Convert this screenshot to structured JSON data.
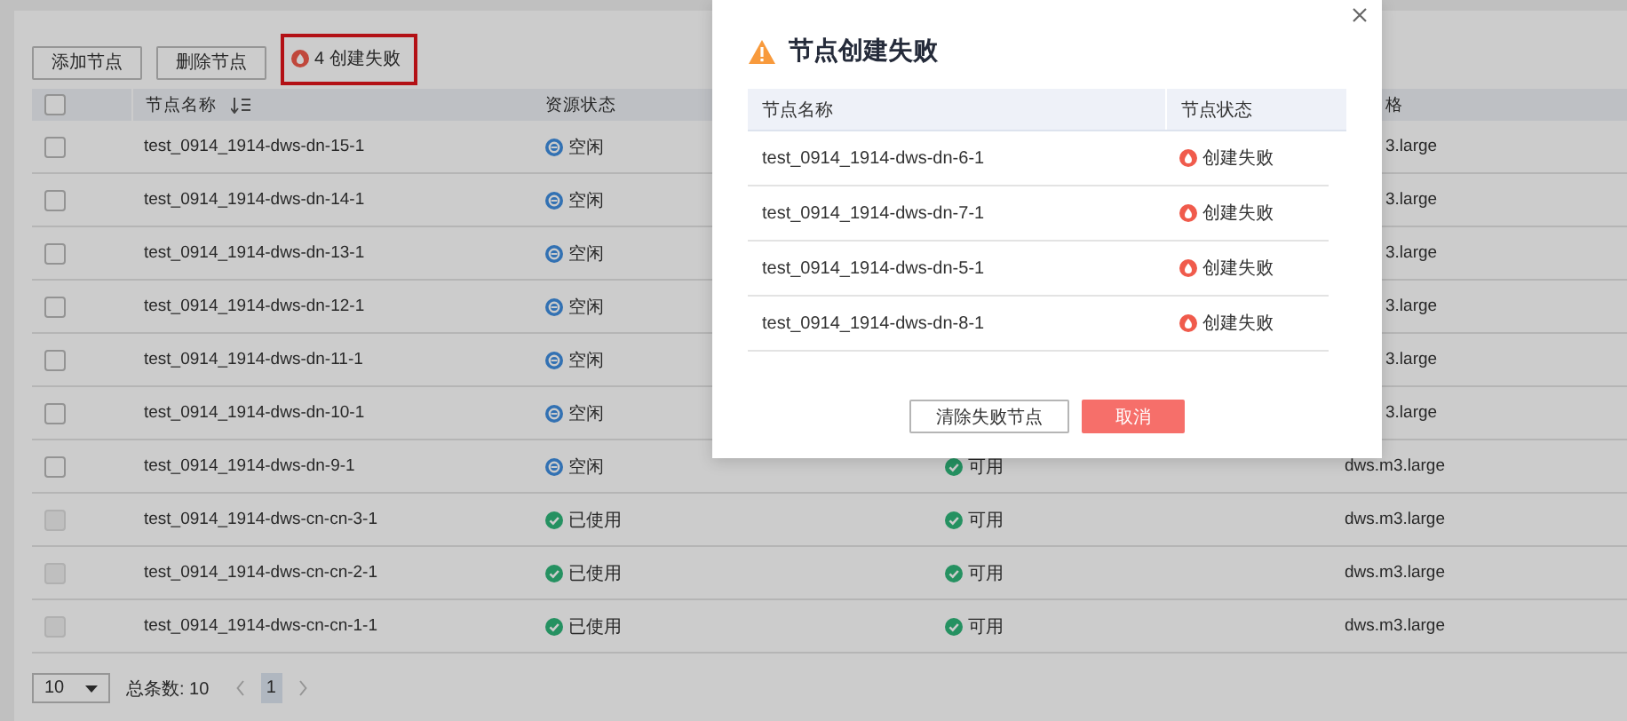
{
  "toolbar": {
    "buttons": [
      {
        "label": "添加节点"
      },
      {
        "label": "删除节点"
      }
    ],
    "failure_notice": {
      "text": "4 创建失败",
      "highlighted": true
    }
  },
  "table": {
    "header": {
      "checked": false,
      "name": "节点名称",
      "resource_status": "资源状态",
      "column_5": "格"
    },
    "rows": [
      {
        "checked": false,
        "disabled": false,
        "name": "test_0914_1914-dws-dn-15-1",
        "resource_status": {
          "kind": "idle",
          "text": "空闲"
        },
        "column_5": "3.large"
      },
      {
        "checked": false,
        "disabled": false,
        "name": "test_0914_1914-dws-dn-14-1",
        "resource_status": {
          "kind": "idle",
          "text": "空闲"
        },
        "column_5": "3.large"
      },
      {
        "checked": false,
        "disabled": false,
        "name": "test_0914_1914-dws-dn-13-1",
        "resource_status": {
          "kind": "idle",
          "text": "空闲"
        },
        "column_5": "3.large"
      },
      {
        "checked": false,
        "disabled": false,
        "name": "test_0914_1914-dws-dn-12-1",
        "resource_status": {
          "kind": "idle",
          "text": "空闲"
        },
        "column_5": "3.large"
      },
      {
        "checked": false,
        "disabled": false,
        "name": "test_0914_1914-dws-dn-11-1",
        "resource_status": {
          "kind": "idle",
          "text": "空闲"
        },
        "column_5": "3.large"
      },
      {
        "checked": false,
        "disabled": false,
        "name": "test_0914_1914-dws-dn-10-1",
        "resource_status": {
          "kind": "idle",
          "text": "空闲"
        },
        "column_5": "3.large"
      },
      {
        "checked": false,
        "disabled": false,
        "name": "test_0914_1914-dws-dn-9-1",
        "resource_status": {
          "kind": "idle",
          "text": "空闲"
        },
        "column_4": {
          "kind": "ok",
          "text": "可用"
        },
        "column_5": "dws.m3.large"
      },
      {
        "checked": false,
        "disabled": true,
        "name": "test_0914_1914-dws-cn-cn-3-1",
        "resource_status": {
          "kind": "ok",
          "text": "已使用"
        },
        "column_4": {
          "kind": "ok",
          "text": "可用"
        },
        "column_5": "dws.m3.large"
      },
      {
        "checked": false,
        "disabled": true,
        "name": "test_0914_1914-dws-cn-cn-2-1",
        "resource_status": {
          "kind": "ok",
          "text": "已使用"
        },
        "column_4": {
          "kind": "ok",
          "text": "可用"
        },
        "column_5": "dws.m3.large"
      },
      {
        "checked": false,
        "disabled": true,
        "name": "test_0914_1914-dws-cn-cn-1-1",
        "resource_status": {
          "kind": "ok",
          "text": "已使用"
        },
        "column_4": {
          "kind": "ok",
          "text": "可用"
        },
        "column_5": "dws.m3.large"
      }
    ]
  },
  "pagination": {
    "page_size": "10",
    "total": "总条数: 10",
    "pages": [
      {
        "label": "1",
        "selected": true
      }
    ]
  },
  "dialog": {
    "title": "节点创建失败",
    "columns": [
      "节点名称",
      "节点状态"
    ],
    "rows": [
      {
        "name": "test_0914_1914-dws-dn-6-1",
        "status": {
          "kind": "failed",
          "text": "创建失败"
        }
      },
      {
        "name": "test_0914_1914-dws-dn-7-1",
        "status": {
          "kind": "failed",
          "text": "创建失败"
        }
      },
      {
        "name": "test_0914_1914-dws-dn-5-1",
        "status": {
          "kind": "failed",
          "text": "创建失败"
        }
      },
      {
        "name": "test_0914_1914-dws-dn-8-1",
        "status": {
          "kind": "failed",
          "text": "创建失败"
        }
      }
    ],
    "buttons": [
      {
        "label": "清除失败节点",
        "kind": "secondary"
      },
      {
        "label": "取消",
        "kind": "primary"
      }
    ]
  }
}
